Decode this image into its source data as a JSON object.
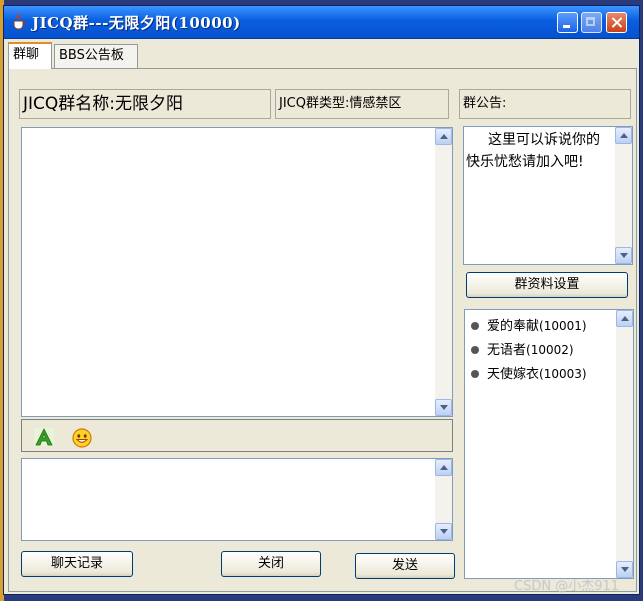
{
  "window": {
    "title": "JICQ群---无限夕阳(10000)"
  },
  "tabs": [
    {
      "label": "群聊"
    },
    {
      "label": "BBS公告板"
    }
  ],
  "group_info": {
    "name_label": "JICQ群名称:无限夕阳",
    "type_label": "JICQ群类型:情感禁区",
    "announce_title": "群公告:"
  },
  "announcement": {
    "text": "这里可以诉说你的快乐忧愁请加入吧!"
  },
  "buttons": {
    "settings": "群资料设置",
    "history": "聊天记录",
    "close": "关闭",
    "send": "发送"
  },
  "members": [
    {
      "name": "爱的奉献",
      "id": "(10001)"
    },
    {
      "name": "无语者",
      "id": "(10002)"
    },
    {
      "name": "天使嫁衣",
      "id": "(10003)"
    }
  ],
  "watermark": "CSDN @小杰911",
  "icons": {
    "window": "java-cup-icon",
    "font": "font-a-icon",
    "emoji": "smiley-icon"
  },
  "colors": {
    "titlebar": "#0552cf",
    "accent_tab": "#e68b2c"
  }
}
